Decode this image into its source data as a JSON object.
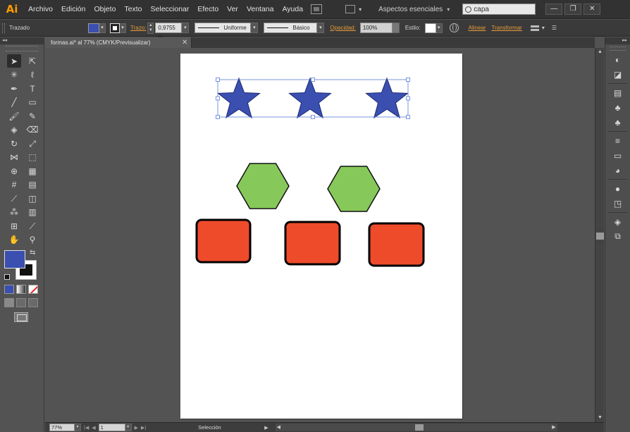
{
  "app": {
    "logo": "Ai"
  },
  "menu": [
    "Archivo",
    "Edición",
    "Objeto",
    "Texto",
    "Seleccionar",
    "Efecto",
    "Ver",
    "Ventana",
    "Ayuda"
  ],
  "workspace": {
    "label": "Aspectos esenciales",
    "caret": "▾"
  },
  "search": {
    "value": "capa"
  },
  "window_buttons": {
    "minimize": "—",
    "restore": "❐",
    "close": "✕"
  },
  "controlbar": {
    "selection_label": "Trazado",
    "fill_color": "#3a4fb0",
    "stroke_label": "Trazo:",
    "stroke_weight": "0,9755 m",
    "uniform_label": "Uniforme",
    "brush_label": "Básico",
    "opacity_label": "Opacidad:",
    "opacity_value": "100%",
    "style_label": "Estilo:",
    "align_label": "Alinear",
    "transform_label": "Transformar",
    "dropdown_glyph": "▾"
  },
  "document": {
    "tab_title": "formas.ai* al 77% (CMYK/Previsualizar)",
    "close_glyph": "✕"
  },
  "tools": [
    {
      "name": "selection-tool",
      "glyph": "➤",
      "active": true
    },
    {
      "name": "direct-selection-tool",
      "glyph": "⇱"
    },
    {
      "name": "magic-wand-tool",
      "glyph": "✳"
    },
    {
      "name": "lasso-tool",
      "glyph": "ℓ"
    },
    {
      "name": "pen-tool",
      "glyph": "✒"
    },
    {
      "name": "type-tool",
      "glyph": "T"
    },
    {
      "name": "line-segment-tool",
      "glyph": "╱"
    },
    {
      "name": "rectangle-tool",
      "glyph": "▭"
    },
    {
      "name": "paintbrush-tool",
      "glyph": "🖌"
    },
    {
      "name": "pencil-tool",
      "glyph": "✎"
    },
    {
      "name": "blob-brush-tool",
      "glyph": "◈"
    },
    {
      "name": "eraser-tool",
      "glyph": "⌫"
    },
    {
      "name": "rotate-tool",
      "glyph": "↻"
    },
    {
      "name": "scale-tool",
      "glyph": "⤢"
    },
    {
      "name": "width-tool",
      "glyph": "⋈"
    },
    {
      "name": "free-transform-tool",
      "glyph": "⬚"
    },
    {
      "name": "shape-builder-tool",
      "glyph": "⊕"
    },
    {
      "name": "perspective-grid-tool",
      "glyph": "▦"
    },
    {
      "name": "mesh-tool",
      "glyph": "#"
    },
    {
      "name": "gradient-tool",
      "glyph": "▤"
    },
    {
      "name": "eyedropper-tool",
      "glyph": "⟋"
    },
    {
      "name": "blend-tool",
      "glyph": "◫"
    },
    {
      "name": "symbol-sprayer-tool",
      "glyph": "⁂"
    },
    {
      "name": "column-graph-tool",
      "glyph": "▥"
    },
    {
      "name": "artboard-tool",
      "glyph": "⊞"
    },
    {
      "name": "slice-tool",
      "glyph": "⟋"
    },
    {
      "name": "hand-tool",
      "glyph": "✋"
    },
    {
      "name": "zoom-tool",
      "glyph": "⚲"
    }
  ],
  "colors": {
    "fill": "#3a4fb0",
    "star_fill": "#3a4fb0",
    "hexagon_fill": "#86c95a",
    "square_fill": "#ee4b2b",
    "selection": "#5a7ad6",
    "chrome_dark": "#323232",
    "canvas_bg": "#535353"
  },
  "artwork": {
    "stars": 3,
    "hexagons": 2,
    "rounded_squares": 3,
    "selected_group": "stars"
  },
  "right_panels": [
    {
      "name": "color-guide-icon",
      "glyph": "◐"
    },
    {
      "name": "swatches-panel-icon",
      "glyph": "◪"
    },
    {
      "name": "brushes-panel-icon",
      "glyph": "▤"
    },
    {
      "name": "symbols-panel-icon",
      "glyph": "♣"
    },
    {
      "name": "symbol-sprayer-panel-icon",
      "glyph": "♣"
    },
    {
      "name": "stroke-panel-icon",
      "glyph": "≡"
    },
    {
      "name": "gradient-panel-icon",
      "glyph": "▭"
    },
    {
      "name": "transparency-panel-icon",
      "glyph": "◕"
    },
    {
      "name": "appearance-panel-icon",
      "glyph": "●"
    },
    {
      "name": "graphic-styles-panel-icon",
      "glyph": "◳"
    },
    {
      "name": "layers-panel-icon",
      "glyph": "◈"
    },
    {
      "name": "artboards-panel-icon",
      "glyph": "⧉"
    }
  ],
  "status": {
    "zoom": "77%",
    "artboard_number": "1",
    "tool_label": "Selección",
    "first": "|◀",
    "prev": "◀",
    "next": "▶",
    "last": "▶|",
    "left_arrow": "◀",
    "right_arrow": "▶",
    "up_arrow": "▲",
    "down_arrow": "▼",
    "panel_collapse": "◂◂",
    "panel_expand": "▸▸"
  }
}
